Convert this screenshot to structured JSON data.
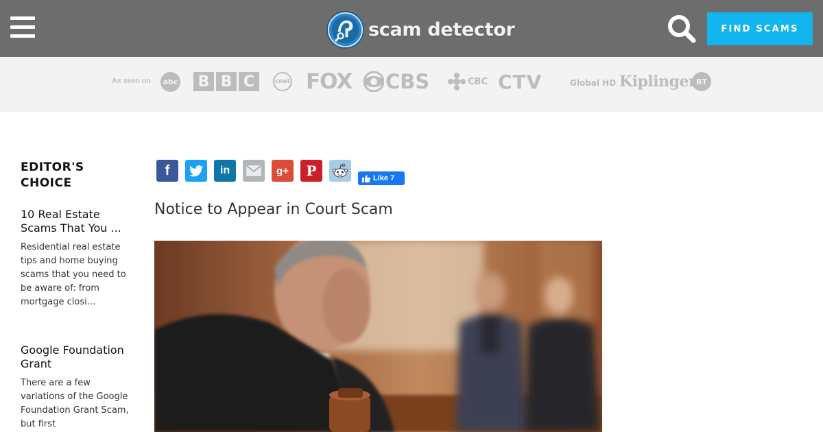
{
  "header": {
    "logo_text": "scam detector",
    "find_button": "FIND SCAMS",
    "colors": {
      "bar": "#6d6d6d",
      "accent": "#12b5ee"
    }
  },
  "as_seen_on": {
    "label": "As seen on",
    "brands": [
      "abc",
      "BBC",
      "cnet",
      "FOX",
      "CBS",
      "CBC",
      "CTV",
      "Global HD",
      "Kiplinger",
      "BT"
    ]
  },
  "sidebar": {
    "heading": "EDITOR'S CHOICE",
    "items": [
      {
        "title": "10 Real Estate Scams That You ...",
        "desc": "Residential real estate tips and home buying scams that you need to be aware of: from mortgage closi..."
      },
      {
        "title": "Google Foundation Grant",
        "desc": "There are a few variations of the Google Foundation Grant Scam, but first"
      }
    ]
  },
  "share": {
    "buttons": [
      "facebook-icon",
      "twitter-icon",
      "linkedin-icon",
      "email-icon",
      "google-plus-icon",
      "pinterest-icon",
      "reddit-icon"
    ],
    "fb_like_label": "Like 7"
  },
  "article": {
    "title": "Notice to Appear in Court Scam"
  }
}
